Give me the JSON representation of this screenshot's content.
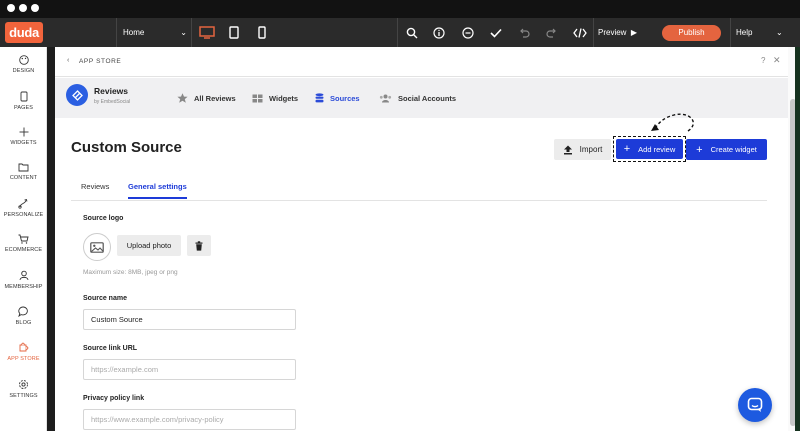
{
  "toolbar": {
    "logo": "duda",
    "page_select": "Home",
    "preview_label": "Preview",
    "publish_label": "Publish",
    "help_label": "Help",
    "accent_color": "#e4643f"
  },
  "sidebar": {
    "items": [
      {
        "label": "DESIGN",
        "icon": "palette-icon"
      },
      {
        "label": "PAGES",
        "icon": "pages-icon"
      },
      {
        "label": "WIDGETS",
        "icon": "plus-icon"
      },
      {
        "label": "CONTENT",
        "icon": "folder-icon"
      },
      {
        "label": "PERSONALIZE",
        "icon": "personalize-icon"
      },
      {
        "label": "ECOMMERCE",
        "icon": "cart-icon"
      },
      {
        "label": "MEMBERSHIP",
        "icon": "member-icon"
      },
      {
        "label": "BLOG",
        "icon": "chat-icon"
      },
      {
        "label": "APP STORE",
        "icon": "puzzle-icon",
        "active": true
      },
      {
        "label": "SETTINGS",
        "icon": "gear-icon"
      }
    ]
  },
  "panel": {
    "title": "APP STORE",
    "help": "?",
    "close": "✕"
  },
  "app": {
    "name": "Reviews",
    "by": "by EmbedSocial",
    "nav": [
      {
        "label": "All Reviews",
        "icon": "star-icon"
      },
      {
        "label": "Widgets",
        "icon": "grid-icon"
      },
      {
        "label": "Sources",
        "icon": "database-icon",
        "active": true
      },
      {
        "label": "Social Accounts",
        "icon": "people-icon"
      }
    ]
  },
  "main": {
    "heading": "Custom Source",
    "import_label": "Import",
    "add_review_label": "Add review",
    "create_widget_label": "Create widget",
    "tabs": [
      {
        "label": "Reviews"
      },
      {
        "label": "General settings",
        "active": true
      }
    ]
  },
  "form": {
    "source_logo_label": "Source logo",
    "upload_label": "Upload photo",
    "hint": "Maximum size: 8MB, jpeg or png",
    "source_name_label": "Source name",
    "source_name_value": "Custom Source",
    "source_link_label": "Source link URL",
    "source_link_placeholder": "https://example.com",
    "privacy_label": "Privacy policy link",
    "privacy_placeholder": "https://www.example.com/privacy-policy"
  },
  "colors": {
    "primary_blue": "#1d3bd8",
    "app_logo_blue": "#2b5fe2"
  }
}
